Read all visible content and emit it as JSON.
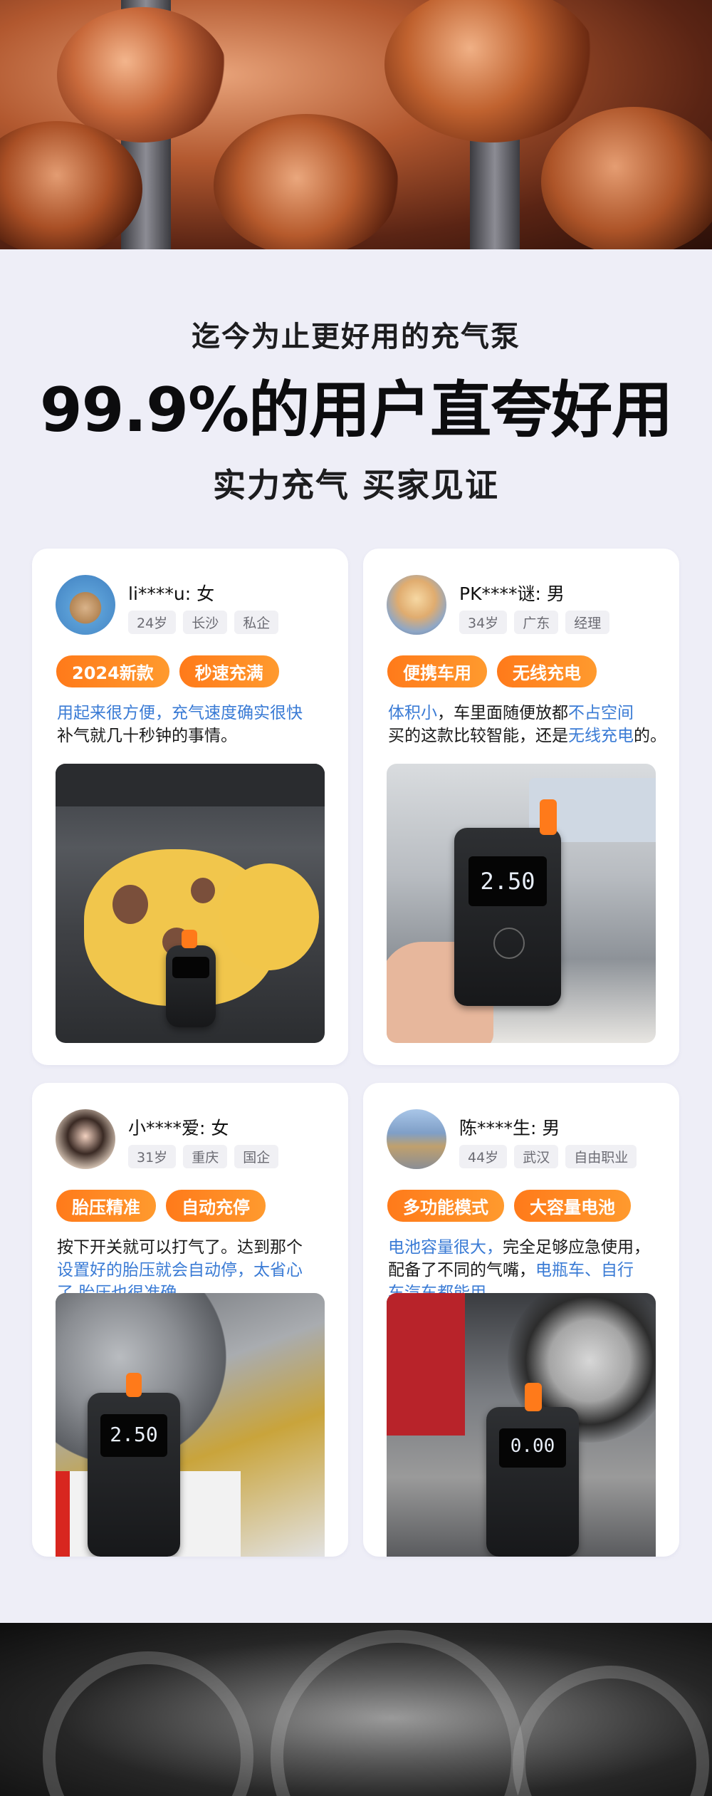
{
  "header": {
    "subtitle": "迄今为止更好用的充气泵",
    "title": "99.9%的用户直夸好用",
    "tagline": "实力充气 买家见证"
  },
  "reviews": [
    {
      "user": "li****u: 女",
      "meta": [
        "24岁",
        "长沙",
        "私企"
      ],
      "badges": [
        "2024新款",
        "秒速充满"
      ],
      "text": {
        "p1": "用起来很方便，充气速度确实很快",
        "p2": "补气就几十秒钟的事情。"
      },
      "device_reading": ""
    },
    {
      "user": "PK****谜: 男",
      "meta": [
        "34岁",
        "广东",
        "经理"
      ],
      "badges": [
        "便携车用",
        "无线充电"
      ],
      "text": {
        "p1": "体积小",
        "p2": "，车里面随便放都",
        "p3": "不占空间",
        "p4": "买的这款比较智能，还是",
        "p5": "无线充电",
        "p6": "的。"
      },
      "device_reading": "2.50"
    },
    {
      "user": "小****爱: 女",
      "meta": [
        "31岁",
        "重庆",
        "国企"
      ],
      "badges": [
        "胎压精准",
        "自动充停"
      ],
      "text": {
        "p1": "按下开关就可以打气了。达到那个",
        "p2": "设置好的胎压就会自动停，太省心",
        "p3": "了,胎压也很准确。"
      },
      "device_reading": "2.50"
    },
    {
      "user": "陈****生: 男",
      "meta": [
        "44岁",
        "武汉",
        "自由职业"
      ],
      "badges": [
        "多功能模式",
        "大容量电池"
      ],
      "text": {
        "p1": "电池容量很大，",
        "p2": "完全足够应急使用，",
        "p3": "配备了不同的气嘴，",
        "p4": "电瓶车、自行",
        "p5": "车汽车都能用。"
      },
      "device_reading": "0.00"
    }
  ],
  "colors": {
    "accent_orange": "#ff7a1a",
    "highlight_blue": "#3a7bd5",
    "page_bg": "#eeeef7"
  }
}
